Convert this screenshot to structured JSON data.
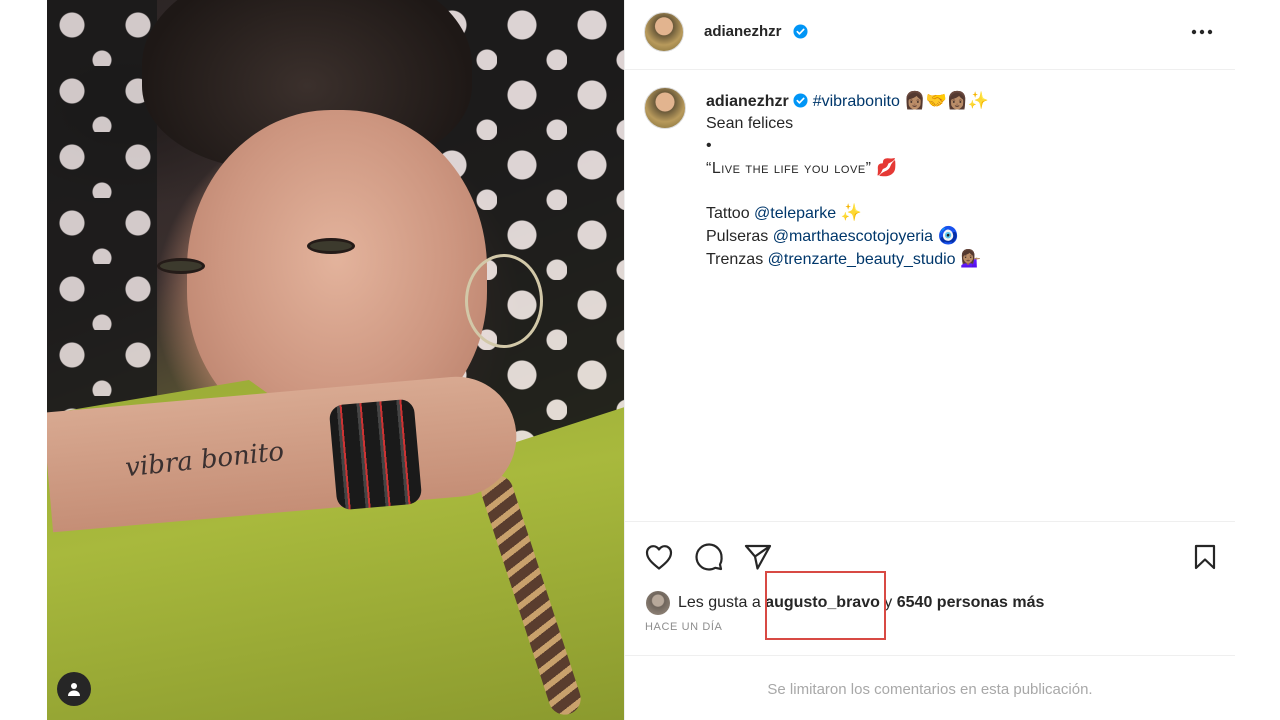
{
  "post": {
    "username": "adianezhzr",
    "tattoo_text": "vibra bonito",
    "caption": {
      "hashtag": "#vibrabonito",
      "hashtag_emoji": "👩🏽‍🤝‍👩🏽✨",
      "line1": "Sean felices",
      "bullet": "•",
      "quote": "“Live the life you love”",
      "quote_emoji": "💋",
      "tattoo_label": "Tattoo",
      "tattoo_handle": "@teleparke",
      "tattoo_emoji": "✨",
      "bracelets_label": "Pulseras",
      "bracelets_handle": "@marthaescotojoyeria",
      "bracelets_emoji": "🧿",
      "braids_label": "Trenzas",
      "braids_handle": "@trenzarte_beauty_studio",
      "braids_emoji": "💁🏽‍♀️"
    },
    "likes": {
      "prefix": "Les gusta a ",
      "first_liker": "augusto_bravo",
      "middle": " y ",
      "others": "6540 personas más"
    },
    "timestamp": "Hace un día",
    "comments_note": "Se limitaron los comentarios en esta publicación."
  },
  "colors": {
    "verified": "#0095f6",
    "link": "#00376b",
    "highlight_box": "#d84a44"
  },
  "icons": [
    "verified-badge-icon",
    "more-options-icon",
    "heart-icon",
    "comment-icon",
    "share-icon",
    "bookmark-icon",
    "user-tag-icon"
  ]
}
